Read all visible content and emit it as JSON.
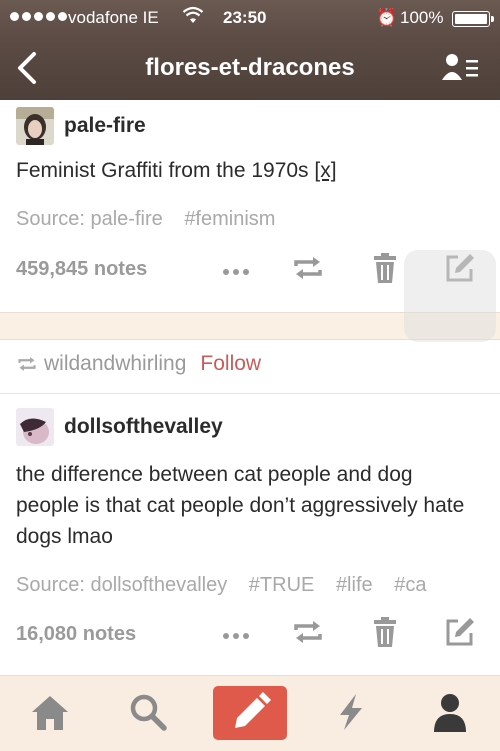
{
  "status_bar": {
    "carrier": "vodafone IE",
    "time": "23:50",
    "battery": "100%"
  },
  "nav": {
    "title": "flores-et-dracones",
    "back_icon": "chevron-left-icon",
    "menu_icon": "user-list-icon"
  },
  "posts": [
    {
      "username": "pale-fire",
      "text": "Feminist Graffiti from the 1970s",
      "link_text": "[x]",
      "source": "Source: pale-fire",
      "tags": [
        "#feminism"
      ],
      "notes": "459,845 notes"
    },
    {
      "reblogged_from": "wildandwhirling",
      "follow_label": "Follow",
      "username": "dollsofthevalley",
      "text": "the difference between cat people and dog people is that cat people don’t aggressively hate dogs lmao",
      "source": "Source: dollsofthevalley",
      "tags": [
        "#TRUE",
        "#life",
        "#ca"
      ],
      "notes": "16,080 notes"
    }
  ],
  "tabbar": {
    "items": [
      "home-icon",
      "search-icon",
      "compose-icon",
      "activity-icon",
      "account-icon"
    ],
    "accent": "#e05a4b"
  }
}
